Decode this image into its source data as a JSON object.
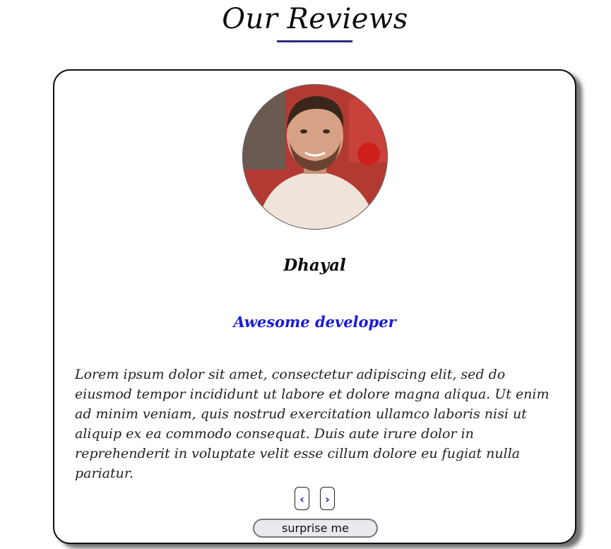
{
  "header": {
    "title": "Our Reviews"
  },
  "review": {
    "avatar_alt": "reviewer photo",
    "name": "Dhayal",
    "role": "Awesome developer",
    "text": "Lorem ipsum dolor sit amet, consectetur adipiscing elit, sed do eiusmod tempor incididunt ut labore et dolore magna aliqua. Ut enim ad minim veniam, quis nostrud exercitation ullamco laboris nisi ut aliquip ex ea commodo consequat. Duis aute irure dolor in reprehenderit in voluptate velit esse cillum dolore eu fugiat nulla pariatur."
  },
  "controls": {
    "prev_label": "‹",
    "next_label": "›",
    "surprise_label": "surprise me"
  },
  "colors": {
    "accent": "#2e2a86",
    "role_text": "#1a1ad8"
  }
}
